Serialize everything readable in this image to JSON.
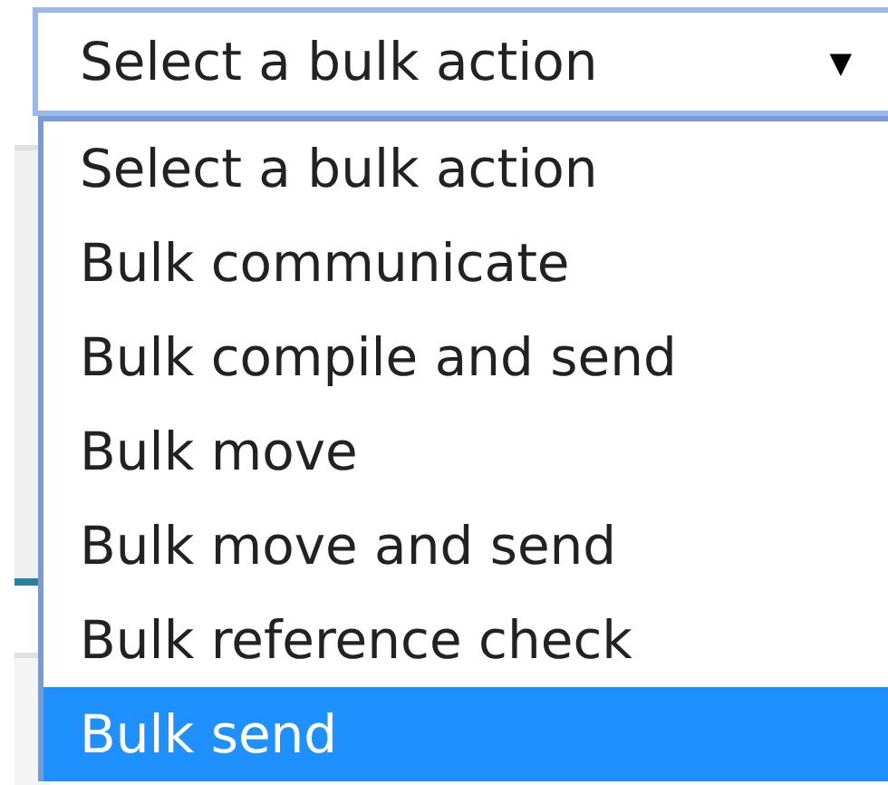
{
  "select": {
    "value": "Select a bulk action",
    "caret": "▼",
    "expanded": true
  },
  "options": [
    {
      "label": "Select a bulk action",
      "selected": false
    },
    {
      "label": "Bulk communicate",
      "selected": false
    },
    {
      "label": "Bulk compile and send",
      "selected": false
    },
    {
      "label": "Bulk move",
      "selected": false
    },
    {
      "label": "Bulk move and send",
      "selected": false
    },
    {
      "label": "Bulk reference check",
      "selected": false
    },
    {
      "label": "Bulk send",
      "selected": true
    }
  ]
}
